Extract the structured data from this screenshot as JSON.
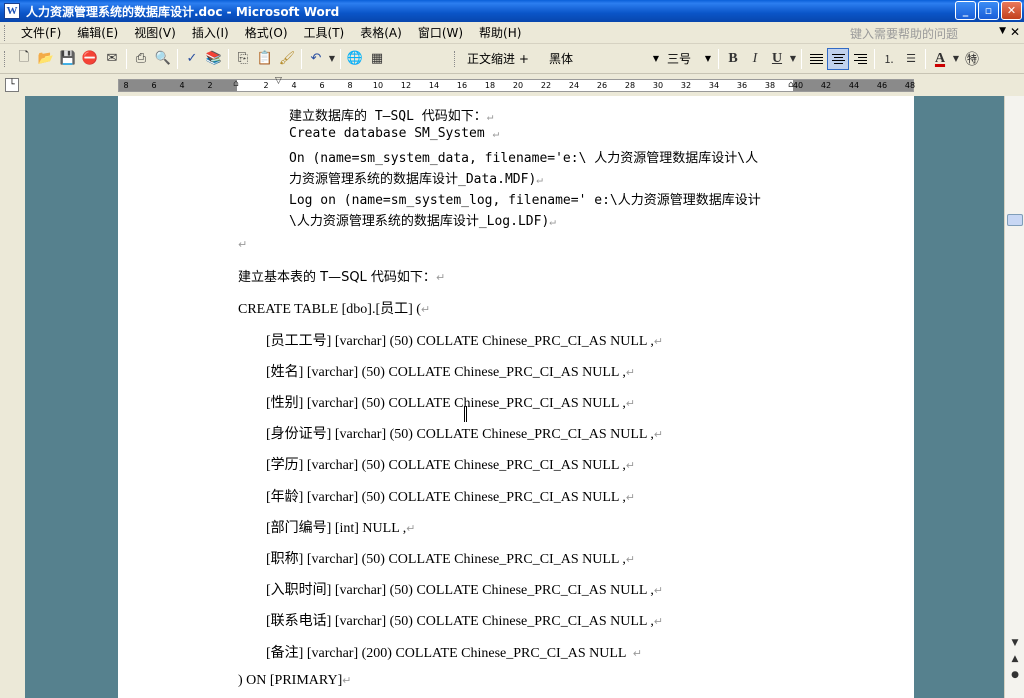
{
  "window": {
    "title": "人力资源管理系统的数据库设计.doc - Microsoft Word",
    "icon": "word-icon"
  },
  "menu": {
    "items": [
      "文件(F)",
      "编辑(E)",
      "视图(V)",
      "插入(I)",
      "格式(O)",
      "工具(T)",
      "表格(A)",
      "窗口(W)",
      "帮助(H)"
    ],
    "help_placeholder": "键入需要帮助的问题"
  },
  "toolbar": {
    "style": "正文缩进 +",
    "font": "黑体",
    "size": "三号",
    "bold": "B",
    "italic": "I",
    "underline": "U",
    "font_color": "A"
  },
  "ruler": {
    "ticks": [
      "8",
      "6",
      "4",
      "2",
      "2",
      "4",
      "6",
      "8",
      "10",
      "12",
      "14",
      "16",
      "18",
      "20",
      "22",
      "24",
      "26",
      "28",
      "30",
      "32",
      "34",
      "36",
      "38",
      "40",
      "42",
      "44",
      "46",
      "48"
    ]
  },
  "document": {
    "lines": [
      "建立数据库的 T—SQL 代码如下：",
      "Create database SM_System",
      "On (name=sm_system_data, filename='e:\\ 人力资源管理数据库设计\\人",
      "力资源管理系统的数据库设计_Data.MDF)",
      "Log on (name=sm_system_log, filename=' e:\\人力资源管理数据库设计",
      "\\人力资源管理系统的数据库设计_Log.LDF)",
      "",
      "建立基本表的 T—SQL 代码如下：",
      "CREATE TABLE [dbo].[员工] (",
      "[员工工号] [varchar] (50) COLLATE Chinese_PRC_CI_AS NULL ,",
      "[姓名] [varchar] (50) COLLATE Chinese_PRC_CI_AS NULL ,",
      "[性别] [varchar] (50) COLLATE Chinese_PRC_CI_AS NULL ,",
      "[身份证号] [varchar] (50) COLLATE Chinese_PRC_CI_AS NULL ,",
      "[学历] [varchar] (50) COLLATE Chinese_PRC_CI_AS NULL ,",
      "[年龄] [varchar] (50) COLLATE Chinese_PRC_CI_AS NULL ,",
      "[部门编号] [int] NULL ,",
      "[职称] [varchar] (50) COLLATE Chinese_PRC_CI_AS NULL ,",
      "[入职时间] [varchar] (50) COLLATE Chinese_PRC_CI_AS NULL ,",
      "[联系电话] [varchar] (50) COLLATE Chinese_PRC_CI_AS NULL ,",
      "[备注] [varchar] (200) COLLATE Chinese_PRC_CI_AS NULL",
      ") ON [PRIMARY]"
    ],
    "paragraph_mark": "↵"
  },
  "colors": {
    "titlebar": "#0a55c8",
    "chrome": "#ece9d8",
    "doc_background": "#56818e",
    "page": "#ffffff"
  }
}
